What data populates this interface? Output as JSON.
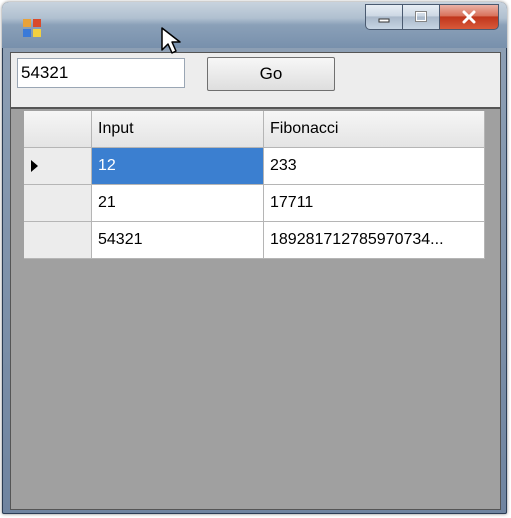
{
  "window": {
    "title": ""
  },
  "toolbar": {
    "input_value": "54321",
    "go_label": "Go"
  },
  "grid": {
    "columns": [
      "Input",
      "Fibonacci"
    ],
    "rows": [
      {
        "input": "12",
        "fibonacci": "233",
        "current": true
      },
      {
        "input": "21",
        "fibonacci": "17711",
        "current": false
      },
      {
        "input": "54321",
        "fibonacci": "189281712785970734...",
        "current": false
      }
    ]
  },
  "icons": {
    "app": "app-icon",
    "minimize": "minimize-icon",
    "maximize": "maximize-icon",
    "close": "close-icon",
    "row_pointer": "row-pointer-icon",
    "cursor": "mouse-cursor-icon"
  },
  "colors": {
    "selection": "#3b7fd0",
    "close_button": "#c0361c",
    "grid_background": "#a0a0a0"
  }
}
